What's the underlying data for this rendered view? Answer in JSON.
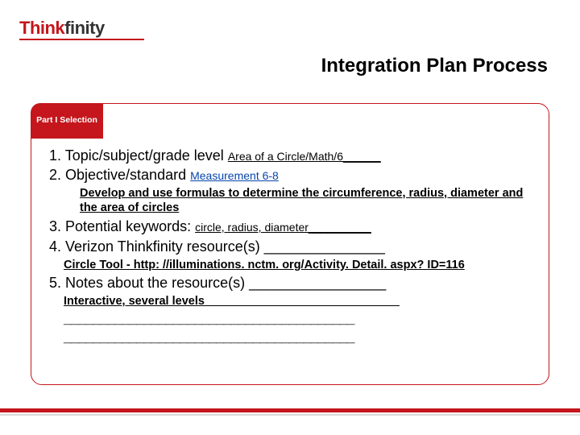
{
  "brand": {
    "word1": "Think",
    "word2": "finity"
  },
  "title": "Integration Plan Process",
  "tab": "Part I Selection",
  "items": {
    "n1": "1. Topic/subject/grade level ",
    "v1": "Area of a Circle/Math/6______",
    "n2": "2.  Objective/standard ",
    "v2": "Measurement 6-8",
    "sub2": "Develop and use formulas to determine the circumference, radius, diameter and the area of circles",
    "n3": "3.  Potential keywords: ",
    "v3": "circle, radius, diameter__________",
    "n4": "4. Verizon Thinkfinity resource(s) _______________",
    "sub4": "Circle Tool - http: //illuminations. nctm. org/Activity. Detail. aspx? ID=116",
    "n5": "5. Notes about the resource(s) _________________",
    "sub5": "Interactive, several levels______________________________",
    "blank": "________________________________________",
    "blank2": "________________________________________"
  }
}
